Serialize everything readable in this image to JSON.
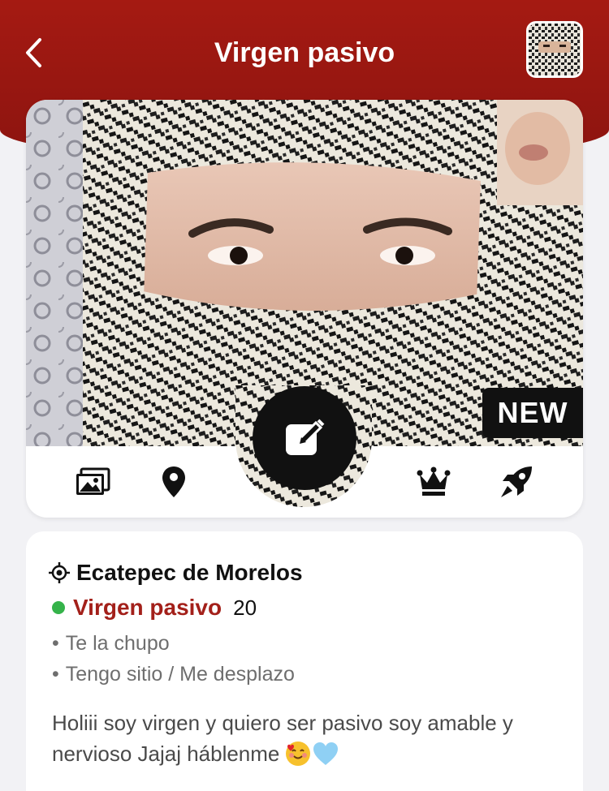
{
  "header": {
    "title": "Virgen pasivo",
    "back_icon": "chevron-left-icon",
    "accent": "#a51a12"
  },
  "photo": {
    "badge": "NEW"
  },
  "action_bar": {
    "icons": [
      "photos-icon",
      "location-pin-icon",
      "edit-icon",
      "crown-icon",
      "rocket-icon"
    ]
  },
  "profile": {
    "location": "Ecatepec de Morelos",
    "name": "Virgen pasivo",
    "age": "20",
    "online_color": "#35b34a",
    "tags": [
      "Te la chupo",
      "Tengo sitio / Me desplazo"
    ],
    "bio": "Holiii soy virgen y quiero ser pasivo soy amable y nervioso Jajaj háblenme"
  }
}
